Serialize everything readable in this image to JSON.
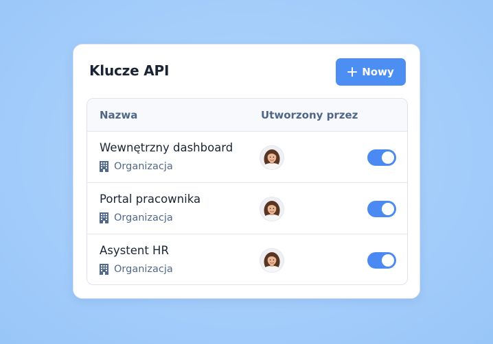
{
  "card": {
    "title": "Klucze API",
    "new_button": {
      "label": "Nowy",
      "icon": "plus-icon"
    }
  },
  "table": {
    "columns": [
      "Nazwa",
      "Utworzony przez"
    ],
    "rows": [
      {
        "name": "Wewnętrzny dashboard",
        "scope": "Organizacja",
        "scope_icon": "building-icon",
        "creator": "avatar",
        "enabled": true
      },
      {
        "name": "Portal pracownika",
        "scope": "Organizacja",
        "scope_icon": "building-icon",
        "creator": "avatar",
        "enabled": true
      },
      {
        "name": "Asystent HR",
        "scope": "Organizacja",
        "scope_icon": "building-icon",
        "creator": "avatar",
        "enabled": true
      }
    ]
  },
  "colors": {
    "accent": "#4d8ef3",
    "toggle_on": "#4a8af2",
    "title": "#1b2434",
    "muted": "#50688a",
    "background": "#a4cdfa"
  }
}
